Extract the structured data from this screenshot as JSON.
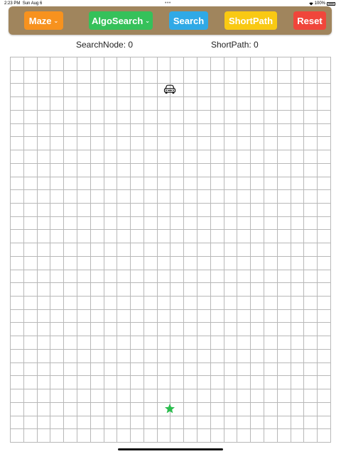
{
  "status_bar": {
    "time": "2:23 PM",
    "date": "Sun Aug 6",
    "multitask_dots": "•••",
    "battery": "100%"
  },
  "toolbar": {
    "maze_label": "Maze",
    "algo_label": "AlgoSearch",
    "search_label": "Search",
    "shortpath_label": "ShortPath",
    "reset_label": "Reset",
    "chevron": "⌄"
  },
  "counters": {
    "search_node": "SearchNode: 0",
    "short_path": "ShortPath: 0"
  },
  "grid": {
    "columns": 24,
    "rows": 29,
    "start_icon": "car-icon",
    "goal_icon": "star-icon"
  },
  "colors": {
    "toolbar_bg": "#a0855d",
    "maze": "#f7921e",
    "algo_search": "#35c15a",
    "search": "#2fa9e6",
    "short_path": "#f9c913",
    "reset": "#f0463b",
    "goal_star": "#2bbd4e",
    "grid_line": "#b8b8b8"
  }
}
